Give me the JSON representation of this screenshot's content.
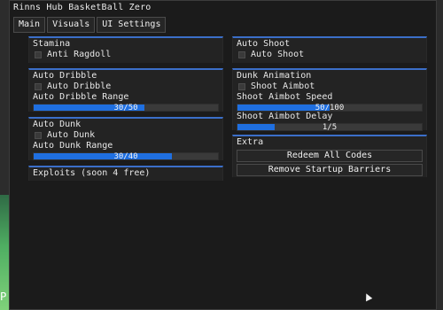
{
  "window": {
    "title": "Rinns Hub BasketBall Zero"
  },
  "tabs": [
    {
      "label": "Main"
    },
    {
      "label": "Visuals"
    },
    {
      "label": "UI Settings"
    }
  ],
  "stamina": {
    "header": "Stamina",
    "anti_ragdoll": "Anti Ragdoll"
  },
  "auto_dribble": {
    "header": "Auto Dribble",
    "toggle": "Auto Dribble",
    "range_label": "Auto Dribble Range",
    "range_text": "30/50",
    "range_fraction": 0.6
  },
  "auto_dunk": {
    "header": "Auto Dunk",
    "toggle": "Auto Dunk",
    "range_label": "Auto Dunk Range",
    "range_text": "30/40",
    "range_fraction": 0.75
  },
  "exploits": {
    "header": "Exploits (soon 4 free)"
  },
  "auto_shoot": {
    "header": "Auto Shoot",
    "toggle": "Auto Shoot"
  },
  "dunk_animation": {
    "header": "Dunk Animation",
    "shoot_aimbot": "Shoot Aimbot",
    "speed_label": "Shoot Aimbot Speed",
    "speed_text": "50/100",
    "speed_fraction": 0.5,
    "delay_label": "Shoot Aimbot Delay",
    "delay_text": "1/5",
    "delay_fraction": 0.2
  },
  "extra": {
    "header": "Extra",
    "redeem_label": "Redeem All Codes",
    "barriers_label": "Remove Startup Barriers"
  },
  "colors": {
    "accent": "#3b6fc9",
    "slider_fill": "#1f6fe0",
    "background": "#1b1b1b"
  }
}
